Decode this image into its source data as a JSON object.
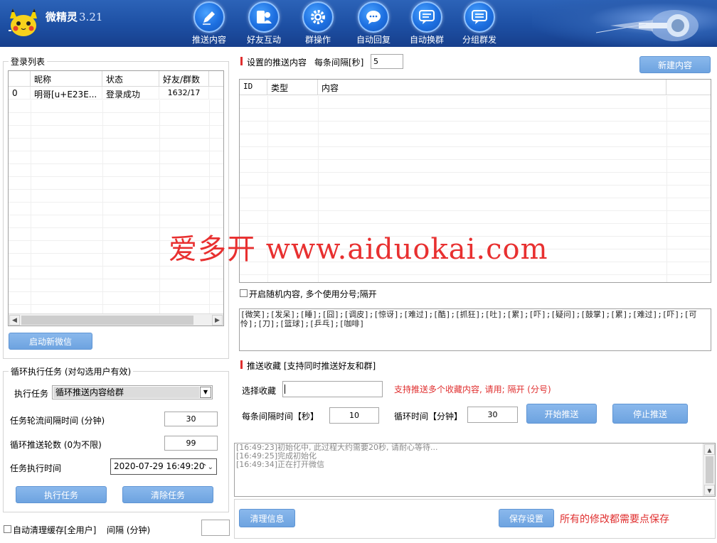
{
  "app": {
    "name": "微精灵",
    "version": "3.21"
  },
  "nav": [
    {
      "label": "推送内容",
      "icon": "pen-icon"
    },
    {
      "label": "好友互动",
      "icon": "friends-icon"
    },
    {
      "label": "群操作",
      "icon": "gear-icon"
    },
    {
      "label": "自动回复",
      "icon": "chat-bubble-icon"
    },
    {
      "label": "自动换群",
      "icon": "message-box-icon"
    },
    {
      "label": "分组群发",
      "icon": "group-message-icon"
    }
  ],
  "login": {
    "title": "登录列表",
    "columns": [
      "",
      "昵称",
      "状态",
      "好友/群数"
    ],
    "rows": [
      {
        "id": "0",
        "nick": "明哥[u+E23E...",
        "status": "登录成功",
        "counts": "1632/17"
      }
    ],
    "new_button": "启动新微信"
  },
  "loop": {
    "title": "循环执行任务 (对勾选用户有效)",
    "task_label": "执行任务",
    "task_value": "循环推送内容给群",
    "interval_label": "任务轮流间隔时间 (分钟)",
    "interval_value": "30",
    "rounds_label": "循环推送轮数 (0为不限)",
    "rounds_value": "99",
    "time_label": "任务执行时间",
    "time_value": "2020-07-29 16:49:20",
    "run_button": "执行任务",
    "clear_button": "清除任务"
  },
  "auto_clean": {
    "label": "自动清理缓存[全用户]",
    "interval_label": "间隔 (分钟)",
    "interval_value": ""
  },
  "push": {
    "title": "设置的推送内容",
    "interval_label": "每条间隔[秒]",
    "interval_value": "5",
    "new_button": "新建内容",
    "columns": [
      "ID",
      "类型",
      "内容"
    ],
    "random_label": "开启随机内容, 多个使用分号;隔开",
    "emoji_text": "[微笑];[发呆];[睡];[囧];[调皮];[惊讶];[难过];[酷];[抓狂];[吐];[累];[吓];[疑问];[鼓掌];[累];[难过];[吓];[可怜];[刀];[篮球];[乒乓];[咖啡]"
  },
  "favorites": {
    "title": "推送收藏 [支持同时推送好友和群]",
    "select_label": "选择收藏",
    "select_value": "",
    "hint": "支持推送多个收藏内容, 请用; 隔开 (分号)",
    "each_interval_label": "每条间隔时间【秒】",
    "each_interval_value": "10",
    "loop_label": "循环时间【分钟】",
    "loop_value": "30",
    "start_button": "开始推送",
    "stop_button": "停止推送"
  },
  "log": [
    "[16:49:23]初始化中, 此过程大约需要20秒, 请耐心等待...",
    "[16:49:25]完成初始化",
    "[16:49:34]正在打开微信"
  ],
  "footer": {
    "clear_button": "清理信息",
    "save_button": "保存设置",
    "save_hint": "所有的修改都需要点保存"
  },
  "watermark": "爱多开 www.aiduokai.com",
  "colors": {
    "header": "#1d4fa3",
    "button": "#6da3e0",
    "accent_red": "#e03030"
  }
}
